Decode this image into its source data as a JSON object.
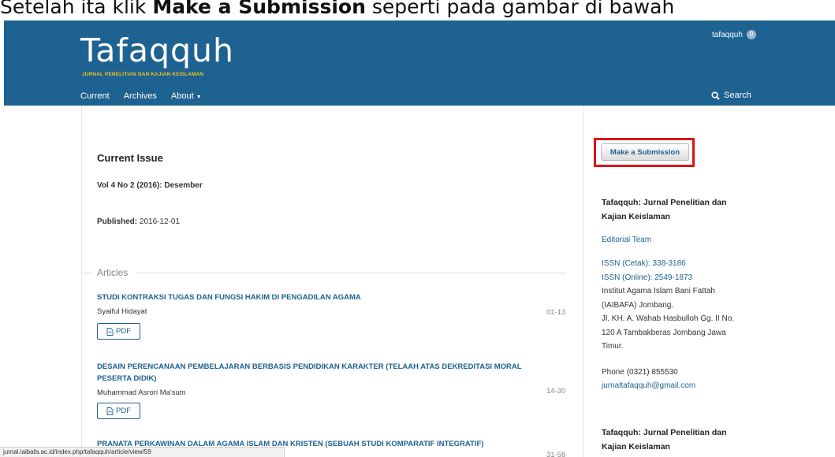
{
  "caption": {
    "prefix": "Setelah ita klik ",
    "bold": "Make a Submission",
    "suffix": " seperti pada gambar di bawah"
  },
  "header": {
    "user": "tafaqquh",
    "notifications": "0",
    "logo": "Tafaqquh",
    "tagline": "JURNAL PENELITIAN DAN KAJIAN KEISLAMAN",
    "nav": [
      "Current",
      "Archives",
      "About"
    ],
    "search_label": "Search"
  },
  "main": {
    "issue_title": "Current Issue",
    "issue_volume": "Vol 4 No 2 (2016): Desember",
    "published_label": "Published:",
    "published_date": "2016-12-01",
    "articles_heading": "Articles",
    "pdf_label": "PDF",
    "articles": [
      {
        "title_lines": [
          "STUDI KONTRAKSI TUGAS DAN FUNGSI HAKIM DI PENGADILAN AGAMA"
        ],
        "author": "Syaiful Hidayat",
        "pages": "01-13"
      },
      {
        "title_lines": [
          "DESAIN PERENCANAAN PEMBELAJARAN BERBASIS PENDIDIKAN KARAKTER (TELAAH ATAS DEKREDITASI MORAL",
          "PESERTA DIDIK)"
        ],
        "author": "Muhammad Asrori Ma'sum",
        "pages": "14-30"
      },
      {
        "title_lines": [
          "PRANATA PERKAWINAN DALAM AGAMA ISLAM DAN KRISTEN (SEBUAH STUDI KOMPARATIF INTEGRATIF)"
        ],
        "author": "",
        "pages": "31-58"
      }
    ]
  },
  "sidebar": {
    "submit_label": "Make a Submission",
    "block1_title_lines": [
      "Tafaqquh: Jurnal Penelitian dan",
      "Kajian Keislaman"
    ],
    "editorial_team": "Editorial Team",
    "issn_print": "ISSN (Cetak): 338-3186",
    "issn_online": "ISSN (Online): 2549-1873",
    "address_lines": [
      "Institut Agama Islam Bani Fattah",
      "(IAIBAFA) Jombang.",
      "Jl. KH. A. Wahab Hasbulloh Gg. II No.",
      "120 A Tambakberas Jombang Jawa",
      "Timur."
    ],
    "phone": "Phone (0321) 855530",
    "email": "jurnaltafaqquh@gmail.com",
    "block2_title_lines": [
      "Tafaqquh: Jurnal Penelitian dan",
      "Kajian Keislaman"
    ]
  },
  "status_bar": {
    "url": "jurnal.iaibafa.ac.id/index.php/tafaqquh/article/view/59"
  },
  "colors": {
    "header_bg": "#1e6292",
    "link": "#1e6292",
    "tagline": "#f2c416",
    "highlight": "#d9141b"
  }
}
